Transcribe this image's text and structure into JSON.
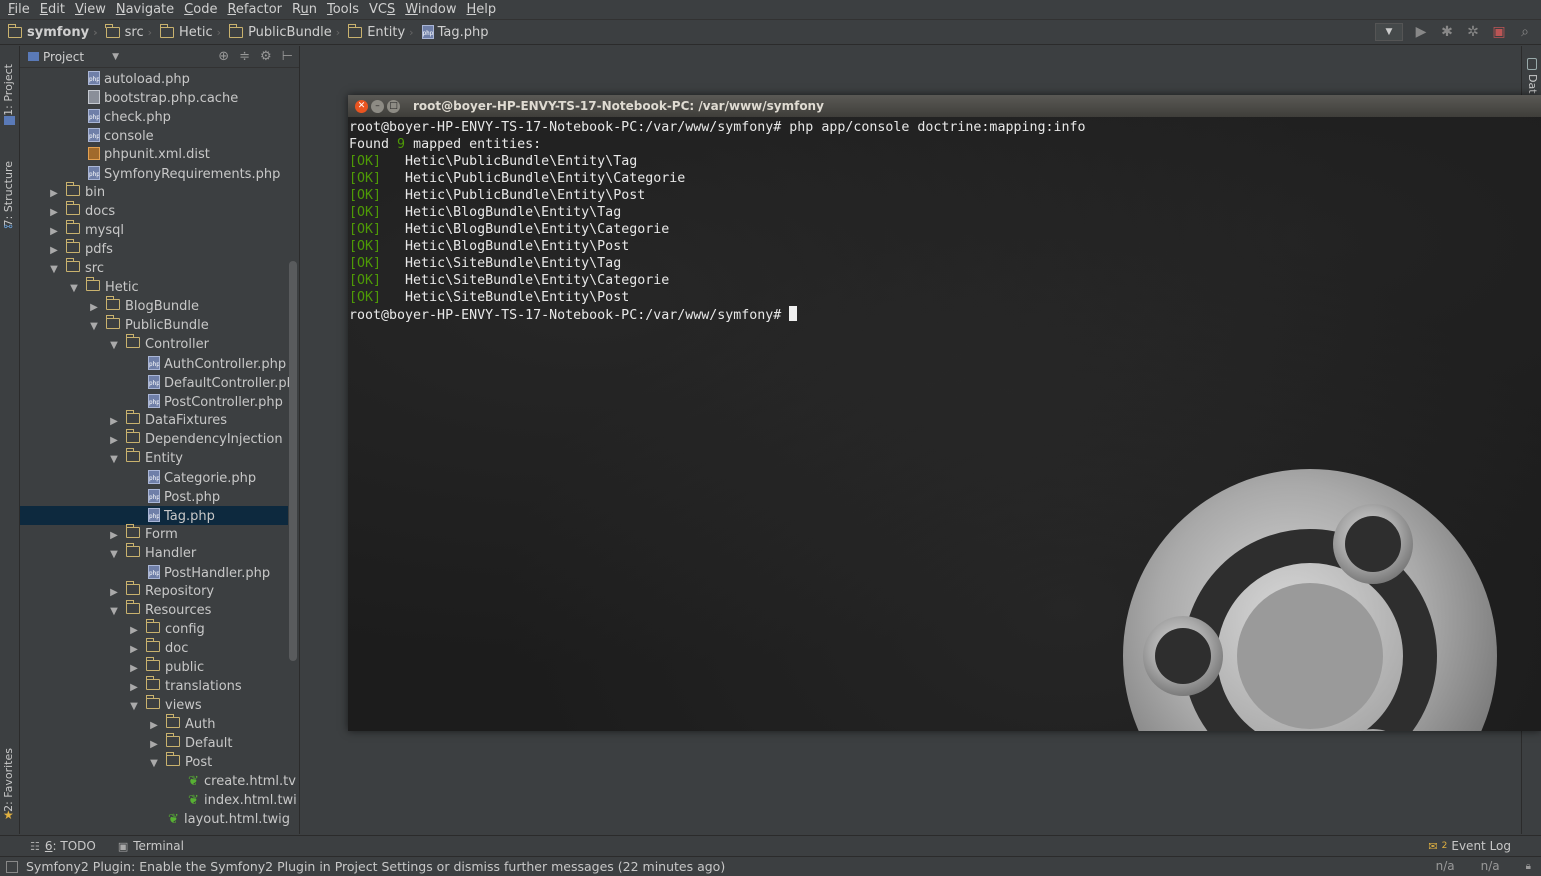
{
  "menu": [
    "File",
    "Edit",
    "View",
    "Navigate",
    "Code",
    "Refactor",
    "Run",
    "Tools",
    "VCS",
    "Window",
    "Help"
  ],
  "menu_mnemonics": [
    "F",
    "E",
    "V",
    "N",
    "C",
    "R",
    "u",
    "T",
    "S",
    "W",
    "H"
  ],
  "breadcrumb": [
    {
      "label": "symfony",
      "icon": "folder-icon"
    },
    {
      "label": "src",
      "icon": "folder-icon"
    },
    {
      "label": "Hetic",
      "icon": "folder-icon"
    },
    {
      "label": "PublicBundle",
      "icon": "folder-icon"
    },
    {
      "label": "Entity",
      "icon": "folder-icon"
    },
    {
      "label": "Tag.php",
      "icon": "php-file-icon"
    }
  ],
  "left_strip": {
    "project_tab": "1: Project",
    "structure_tab": "7: Structure",
    "favorites_tab": "2: Favorites"
  },
  "right_strip": {
    "database_tab": "Dat"
  },
  "project_panel": {
    "title": "Project",
    "tree": [
      {
        "label": "autoload.php",
        "type": "php",
        "depth": 3
      },
      {
        "label": "bootstrap.php.cache",
        "type": "file",
        "depth": 3
      },
      {
        "label": "check.php",
        "type": "php",
        "depth": 3
      },
      {
        "label": "console",
        "type": "php",
        "depth": 3
      },
      {
        "label": "phpunit.xml.dist",
        "type": "xml",
        "depth": 3
      },
      {
        "label": "SymfonyRequirements.php",
        "type": "php",
        "depth": 3
      },
      {
        "label": "bin",
        "type": "folder",
        "state": "collapsed",
        "depth": 1
      },
      {
        "label": "docs",
        "type": "folder",
        "state": "collapsed",
        "depth": 1
      },
      {
        "label": "mysql",
        "type": "folder",
        "state": "collapsed",
        "depth": 1
      },
      {
        "label": "pdfs",
        "type": "folder",
        "state": "collapsed",
        "depth": 1
      },
      {
        "label": "src",
        "type": "folder",
        "state": "expanded",
        "depth": 1
      },
      {
        "label": "Hetic",
        "type": "folder",
        "state": "expanded",
        "depth": 2
      },
      {
        "label": "BlogBundle",
        "type": "folder",
        "state": "collapsed",
        "depth": 3
      },
      {
        "label": "PublicBundle",
        "type": "folder",
        "state": "expanded",
        "depth": 3
      },
      {
        "label": "Controller",
        "type": "folder",
        "state": "expanded",
        "depth": 4
      },
      {
        "label": "AuthController.php",
        "type": "php",
        "depth": 6
      },
      {
        "label": "DefaultController.ph",
        "type": "php",
        "depth": 6
      },
      {
        "label": "PostController.php",
        "type": "php",
        "depth": 6
      },
      {
        "label": "DataFixtures",
        "type": "folder",
        "state": "collapsed",
        "depth": 4
      },
      {
        "label": "DependencyInjection",
        "type": "folder",
        "state": "collapsed",
        "depth": 4
      },
      {
        "label": "Entity",
        "type": "folder",
        "state": "expanded",
        "depth": 4
      },
      {
        "label": "Categorie.php",
        "type": "php",
        "depth": 6
      },
      {
        "label": "Post.php",
        "type": "php",
        "depth": 6
      },
      {
        "label": "Tag.php",
        "type": "php",
        "depth": 6,
        "selected": true
      },
      {
        "label": "Form",
        "type": "folder",
        "state": "collapsed",
        "depth": 4
      },
      {
        "label": "Handler",
        "type": "folder",
        "state": "expanded",
        "depth": 4
      },
      {
        "label": "PostHandler.php",
        "type": "php",
        "depth": 6
      },
      {
        "label": "Repository",
        "type": "folder",
        "state": "collapsed",
        "depth": 4
      },
      {
        "label": "Resources",
        "type": "folder",
        "state": "expanded",
        "depth": 4
      },
      {
        "label": "config",
        "type": "folder",
        "state": "collapsed",
        "depth": 5
      },
      {
        "label": "doc",
        "type": "folder",
        "state": "collapsed",
        "depth": 5
      },
      {
        "label": "public",
        "type": "folder",
        "state": "collapsed",
        "depth": 5
      },
      {
        "label": "translations",
        "type": "folder",
        "state": "collapsed",
        "depth": 5
      },
      {
        "label": "views",
        "type": "folder",
        "state": "expanded",
        "depth": 5
      },
      {
        "label": "Auth",
        "type": "folder",
        "state": "collapsed",
        "depth": 6
      },
      {
        "label": "Default",
        "type": "folder",
        "state": "collapsed",
        "depth": 6
      },
      {
        "label": "Post",
        "type": "folder",
        "state": "expanded",
        "depth": 6
      },
      {
        "label": "create.html.tv",
        "type": "twig",
        "depth": 8
      },
      {
        "label": "index.html.twi",
        "type": "twig",
        "depth": 8
      },
      {
        "label": "layout.html.twig",
        "type": "twig",
        "depth": 7
      }
    ]
  },
  "terminal": {
    "title": "root@boyer-HP-ENVY-TS-17-Notebook-PC: /var/www/symfony",
    "prompt": "root@boyer-HP-ENVY-TS-17-Notebook-PC:/var/www/symfony#",
    "command": "php app/console doctrine:mapping:info",
    "found_prefix": "Found",
    "found_count": "9",
    "found_suffix": "mapped entities:",
    "ok_tag": "[OK]",
    "entities": [
      "Hetic\\PublicBundle\\Entity\\Tag",
      "Hetic\\PublicBundle\\Entity\\Categorie",
      "Hetic\\PublicBundle\\Entity\\Post",
      "Hetic\\BlogBundle\\Entity\\Tag",
      "Hetic\\BlogBundle\\Entity\\Categorie",
      "Hetic\\BlogBundle\\Entity\\Post",
      "Hetic\\SiteBundle\\Entity\\Tag",
      "Hetic\\SiteBundle\\Entity\\Categorie",
      "Hetic\\SiteBundle\\Entity\\Post"
    ]
  },
  "bottom_tools": {
    "todo_number": "6",
    "todo_label": ": TODO",
    "terminal_label": "Terminal",
    "event_log_count": "2",
    "event_log_label": "Event Log"
  },
  "status": {
    "message": "Symfony2 Plugin: Enable the Symfony2 Plugin in Project Settings or dismiss further messages (22 minutes ago)",
    "pos1": "n/a",
    "pos2": "n/a"
  },
  "colors": {
    "ide_bg": "#3c3f41",
    "selection": "#0d293e",
    "terminal_ok": "#4e9a06",
    "ubuntu_orange": "#e95420"
  }
}
